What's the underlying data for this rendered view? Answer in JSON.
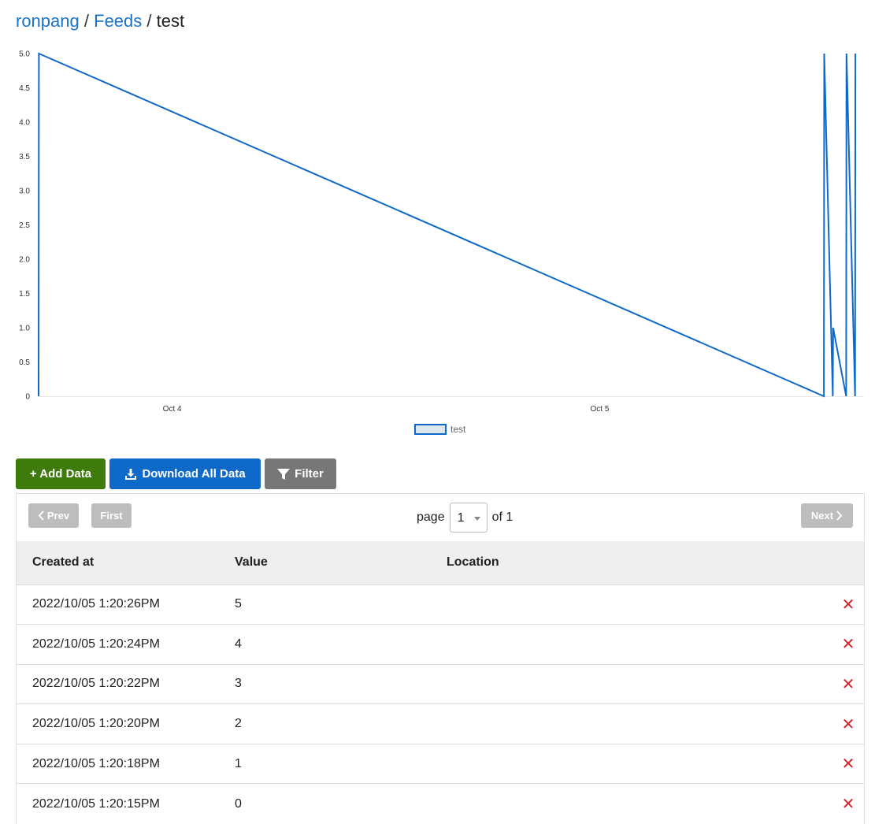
{
  "breadcrumb": {
    "user": "ronpang",
    "sep1": "/",
    "section": "Feeds",
    "sep2": "/",
    "current": "test"
  },
  "chart_data": {
    "type": "line",
    "y_ticks": [
      "0",
      "0.5",
      "1.0",
      "1.5",
      "2.0",
      "2.5",
      "3.0",
      "3.5",
      "4.0",
      "4.5",
      "5.0"
    ],
    "ylim": [
      0,
      5
    ],
    "x_ticks": [
      {
        "label": "Oct 4",
        "time": "2022-10-04T00:00:00"
      },
      {
        "label": "Oct 5",
        "time": "2022-10-05T00:00:00"
      }
    ],
    "xlim": [
      "2022-10-03T16:30:00",
      "2022-10-05T14:50:00"
    ],
    "series": [
      {
        "name": "test",
        "color": "#0f69c9",
        "points": [
          {
            "x": "2022-10-03T16:30:00",
            "y": 0
          },
          {
            "x": "2022-10-03T16:31:00",
            "y": 5
          },
          {
            "x": "2022-10-05T12:35:00",
            "y": 0
          },
          {
            "x": "2022-10-05T12:36:00",
            "y": 5
          },
          {
            "x": "2022-10-05T13:05:00",
            "y": 0
          },
          {
            "x": "2022-10-05T13:06:00",
            "y": 1
          },
          {
            "x": "2022-10-05T13:50:00",
            "y": 0
          },
          {
            "x": "2022-10-05T13:51:00",
            "y": 5
          },
          {
            "x": "2022-10-05T14:20:00",
            "y": 0
          },
          {
            "x": "2022-10-05T14:21:00",
            "y": 5
          }
        ]
      }
    ],
    "legend": "bottom-center",
    "grid": false
  },
  "buttons": {
    "add": "+ Add Data",
    "download": "Download All Data",
    "filter": "Filter"
  },
  "pagination": {
    "prev": "Prev",
    "first": "First",
    "next": "Next",
    "page_label": "page",
    "page_value": "1",
    "of_label": "of 1"
  },
  "table": {
    "headers": [
      "Created at",
      "Value",
      "Location"
    ],
    "rows": [
      {
        "created": "2022/10/05 1:20:26PM",
        "value": "5",
        "location": ""
      },
      {
        "created": "2022/10/05 1:20:24PM",
        "value": "4",
        "location": ""
      },
      {
        "created": "2022/10/05 1:20:22PM",
        "value": "3",
        "location": ""
      },
      {
        "created": "2022/10/05 1:20:20PM",
        "value": "2",
        "location": ""
      },
      {
        "created": "2022/10/05 1:20:18PM",
        "value": "1",
        "location": ""
      },
      {
        "created": "2022/10/05 1:20:15PM",
        "value": "0",
        "location": ""
      }
    ],
    "delete_icon": "close-icon",
    "delete_color": "#d2232a"
  },
  "colors": {
    "link": "#1a73c6",
    "add_button": "#3e7a0c",
    "download_button": "#0f69c9",
    "filter_button": "#777777"
  }
}
